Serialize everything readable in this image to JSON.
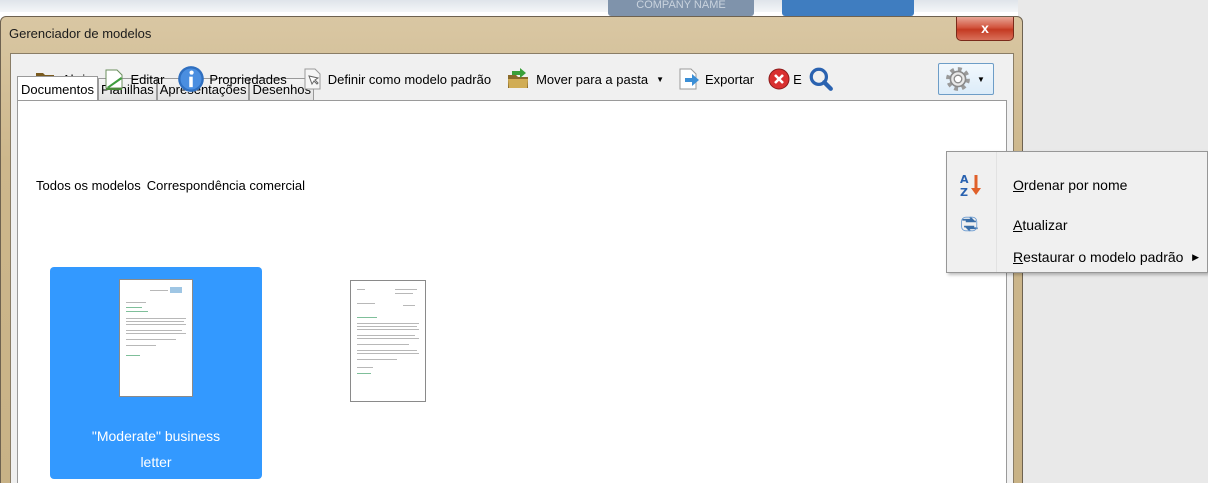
{
  "background": {
    "tab_text": "COMPANY NAME"
  },
  "window": {
    "title": "Gerenciador de modelos",
    "close_label": "x"
  },
  "tabs": [
    {
      "label": "Documentos",
      "active": true
    },
    {
      "label": "Planilhas",
      "active": false
    },
    {
      "label": "Apresentações",
      "active": false
    },
    {
      "label": "Desenhos",
      "active": false
    }
  ],
  "toolbar": {
    "open": {
      "label": "Abrir",
      "icon": "folder-open-icon"
    },
    "edit": {
      "label": "Editar",
      "icon": "edit-document-icon"
    },
    "properties": {
      "label": "Propriedades",
      "icon": "info-icon"
    },
    "set_default": {
      "label": "Definir como modelo padrão",
      "icon": "set-default-icon"
    },
    "move": {
      "label": "Mover para a pasta",
      "icon": "move-to-folder-icon"
    },
    "export": {
      "label": "Exportar",
      "icon": "export-icon"
    },
    "delete": {
      "label": "E",
      "icon": "delete-icon"
    },
    "search": {
      "icon": "search-icon"
    },
    "actions": {
      "icon": "gear-icon"
    }
  },
  "breadcrumb": {
    "root": "Todos os modelos",
    "current": "Correspondência comercial"
  },
  "templates": [
    {
      "name": "\"Moderate\" business",
      "name_line2": "letter",
      "selected": true
    },
    {
      "name": "",
      "name_line2": "",
      "selected": false
    }
  ],
  "menu": {
    "items": [
      {
        "label": "Ordenar por nome",
        "accel": "O",
        "icon": "sort-az-icon"
      },
      {
        "label": "Atualizar",
        "accel": "A",
        "icon": "refresh-icon"
      },
      {
        "label": "Restaurar o modelo padrão",
        "accel": "R",
        "icon": "",
        "submenu": true
      }
    ]
  },
  "colors": {
    "selection": "#3399ff",
    "close_button": "#c43a22",
    "window_frame": "#cdb78c"
  }
}
